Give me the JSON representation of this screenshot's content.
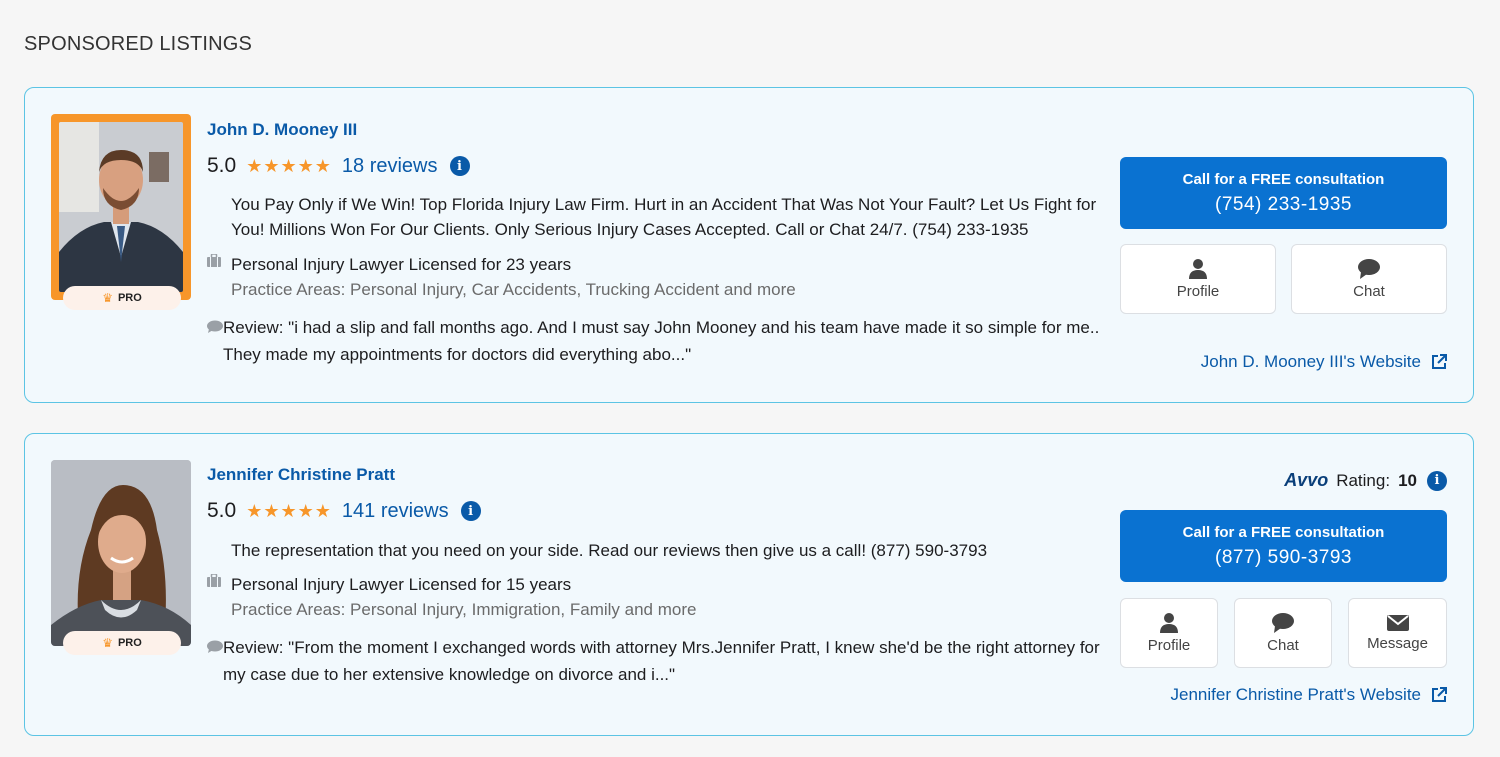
{
  "section_title": "SPONSORED LISTINGS",
  "colors": {
    "accent": "#0a72d1",
    "link": "#0a5aa8",
    "star": "#f7962a",
    "card_border": "#5cc4e4",
    "card_bg": "#f2f9fd"
  },
  "listings": [
    {
      "name": "John D. Mooney III",
      "badge": "PRO",
      "score": "5.0",
      "stars": "★★★★★",
      "reviews_label": "18 reviews",
      "description": "You Pay Only if We Win! Top Florida Injury Law Firm. Hurt in an Accident That Was Not Your Fault? Let Us Fight for You! Millions Won For Our Clients. Only Serious Injury Cases Accepted. Call or Chat 24/7. (754) 233-1935",
      "license": "Personal Injury Lawyer Licensed for 23 years",
      "practice_areas": "Practice Areas:  Personal Injury, Car Accidents, Trucking Accident and more",
      "review": "Review:  \"i had a slip and fall months ago. And I must say John Mooney and his team have made it so simple for me.. They made my appointments for doctors did everything abo...\"",
      "cta_label": "Call for a FREE consultation",
      "cta_phone": "(754) 233-1935",
      "buttons": [
        "Profile",
        "Chat"
      ],
      "website": "John D. Mooney III's Website"
    },
    {
      "name": "Jennifer Christine Pratt",
      "badge": "PRO",
      "score": "5.0",
      "stars": "★★★★★",
      "reviews_label": "141 reviews",
      "avvo_logo": "Avvo",
      "avvo_label": "Rating:",
      "avvo_value": "10",
      "description": "The representation that you need on your side. Read our reviews then give us a call! (877) 590-3793",
      "license": "Personal Injury Lawyer Licensed for 15 years",
      "practice_areas": "Practice Areas:  Personal Injury, Immigration, Family and more",
      "review": "Review:  \"From the moment I exchanged words with attorney Mrs.Jennifer Pratt, I knew she'd be the right attorney for my case due to her extensive knowledge on divorce and i...\"",
      "cta_label": "Call for a FREE consultation",
      "cta_phone": "(877) 590-3793",
      "buttons": [
        "Profile",
        "Chat",
        "Message"
      ],
      "website": "Jennifer Christine Pratt's Website"
    }
  ]
}
